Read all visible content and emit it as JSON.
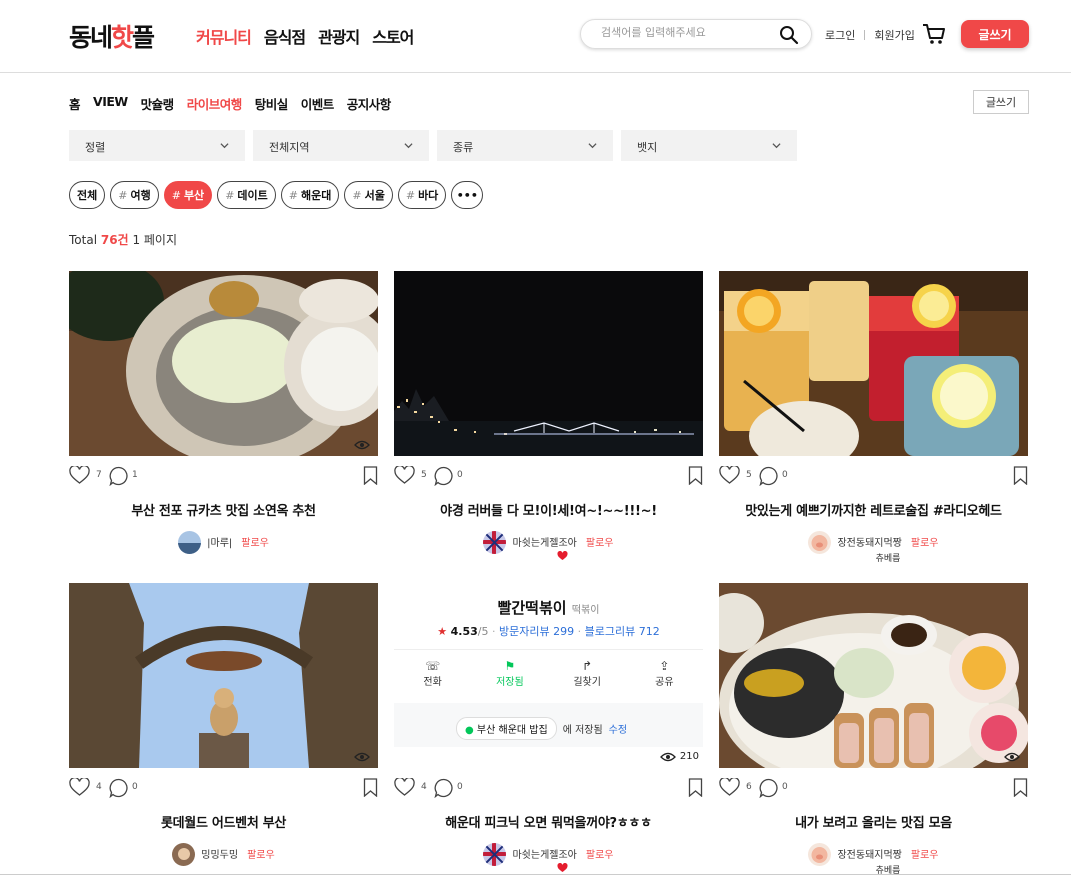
{
  "brand": {
    "logo_pre": "동네",
    "logo_hl": "핫",
    "logo_post": "플"
  },
  "gnb": [
    "커뮤니티",
    "음식점",
    "관광지",
    "스토어"
  ],
  "search": {
    "placeholder": "검색어를 입력해주세요"
  },
  "links": {
    "login": "로그인",
    "signup": "회원가입"
  },
  "write_label": "글쓰기",
  "subnav": [
    "홈",
    "VIEW",
    "맛슐랭",
    "라이브여행",
    "탕비실",
    "이벤트",
    "공지사항"
  ],
  "filters": [
    "정렬",
    "전체지역",
    "종류",
    "뱃지"
  ],
  "tags": {
    "all": "전체",
    "hash": "#",
    "items": [
      "여행",
      "부산",
      "데이트",
      "해운대",
      "서울",
      "바다"
    ],
    "more": "•••"
  },
  "total": {
    "prefix": "Total",
    "count": "76건",
    "page": "1 페이지"
  },
  "cards": [
    {
      "title": "부산 전포 규카츠 맛집 소연옥 추천",
      "likes": "7",
      "comments": "1",
      "views": "",
      "author": "|마루|",
      "follow": "팔로우",
      "badge": ""
    },
    {
      "title": "야경 러버들 다 모!이!세!여~!~~!!!~!",
      "likes": "5",
      "comments": "0",
      "views": "",
      "author": "마쉿는게젤조아",
      "follow": "팔로우",
      "badge": ""
    },
    {
      "title": "맛있는게 예쁘기까지한 레트로술집 #라디오헤드",
      "likes": "5",
      "comments": "0",
      "views": "",
      "author": "장전동돼지먹짱",
      "follow": "팔로우",
      "badge": "츄베름"
    },
    {
      "title": "롯데월드 어드벤처 부산",
      "likes": "4",
      "comments": "0",
      "views": "",
      "author": "밍밍두밍",
      "follow": "팔로우",
      "badge": ""
    },
    {
      "title": "해운대 피크닉 오면 뭐먹을꺼야?ㅎㅎㅎ",
      "likes": "4",
      "comments": "0",
      "views": "210",
      "author": "마쉿는게젤조아",
      "follow": "팔로우",
      "badge": ""
    },
    {
      "title": "내가 보려고 올리는 맛집 모음",
      "likes": "6",
      "comments": "0",
      "views": "",
      "author": "장전동돼지먹짱",
      "follow": "팔로우",
      "badge": "츄베름"
    }
  ],
  "map_card": {
    "name": "빨간떡볶이",
    "category": "떡볶이",
    "rating": "4.53",
    "rating_suffix": "/5",
    "visit_reviews": "방문자리뷰 299",
    "blog_reviews": "블로그리뷰 712",
    "actions": [
      "전화",
      "저장됨",
      "길찾기",
      "공유"
    ],
    "saved_list": "부산 해운대 밥집",
    "saved_text": "에 저장됨",
    "edit": "수정"
  },
  "colors": {
    "accent": "#f04848",
    "map_blue": "#2d6fd8",
    "map_green": "#03c75a"
  }
}
